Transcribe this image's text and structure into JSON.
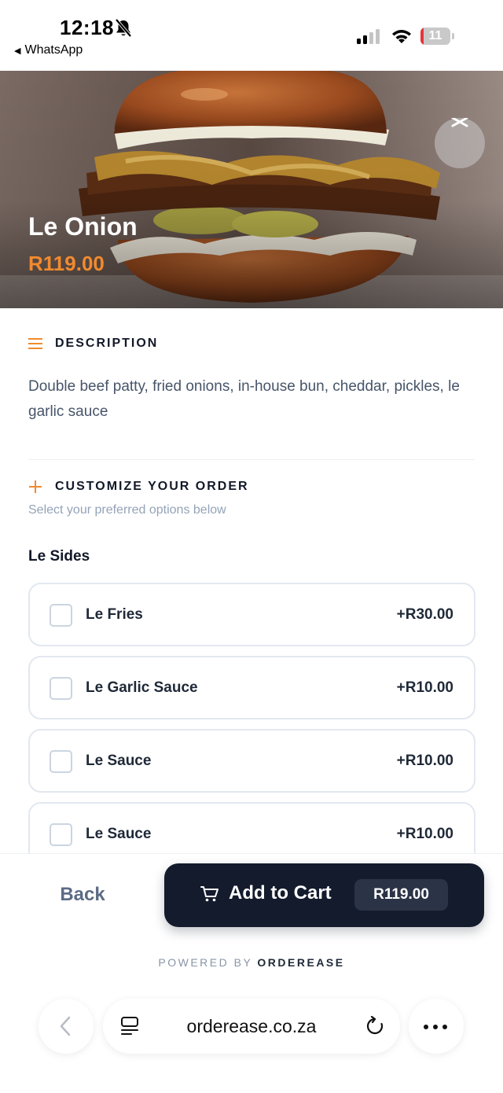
{
  "status_bar": {
    "time": "12:18",
    "back_app": "WhatsApp",
    "battery": "11",
    "icons": [
      "bell-off-icon",
      "signal-icon",
      "wifi-icon",
      "battery-icon"
    ]
  },
  "product": {
    "name": "Le Onion",
    "price": "R119.00",
    "image": "burger-photo",
    "close_icon": "close-icon"
  },
  "description": {
    "heading": "DESCRIPTION",
    "text": "Double beef patty, fried onions, in-house bun, cheddar, pickles, le garlic sauce"
  },
  "customize": {
    "heading": "CUSTOMIZE YOUR ORDER",
    "subtitle": "Select your preferred options below"
  },
  "option_group": {
    "title": "Le Sides",
    "options": [
      {
        "name": "Le Fries",
        "price": "+R30.00",
        "checked": false
      },
      {
        "name": "Le Garlic Sauce",
        "price": "+R10.00",
        "checked": false
      },
      {
        "name": "Le Sauce",
        "price": "+R10.00",
        "checked": false
      },
      {
        "name": "Le Sauce",
        "price": "+R10.00",
        "checked": false
      }
    ]
  },
  "actions": {
    "back": "Back",
    "add_to_cart": "Add to Cart",
    "cart_price": "R119.00"
  },
  "footer": {
    "powered_by": "POWERED BY",
    "brand": "ORDEREASE"
  },
  "browser": {
    "url": "orderease.co.za"
  },
  "colors": {
    "accent": "#f28a2e",
    "button_dark": "#141b2d"
  }
}
